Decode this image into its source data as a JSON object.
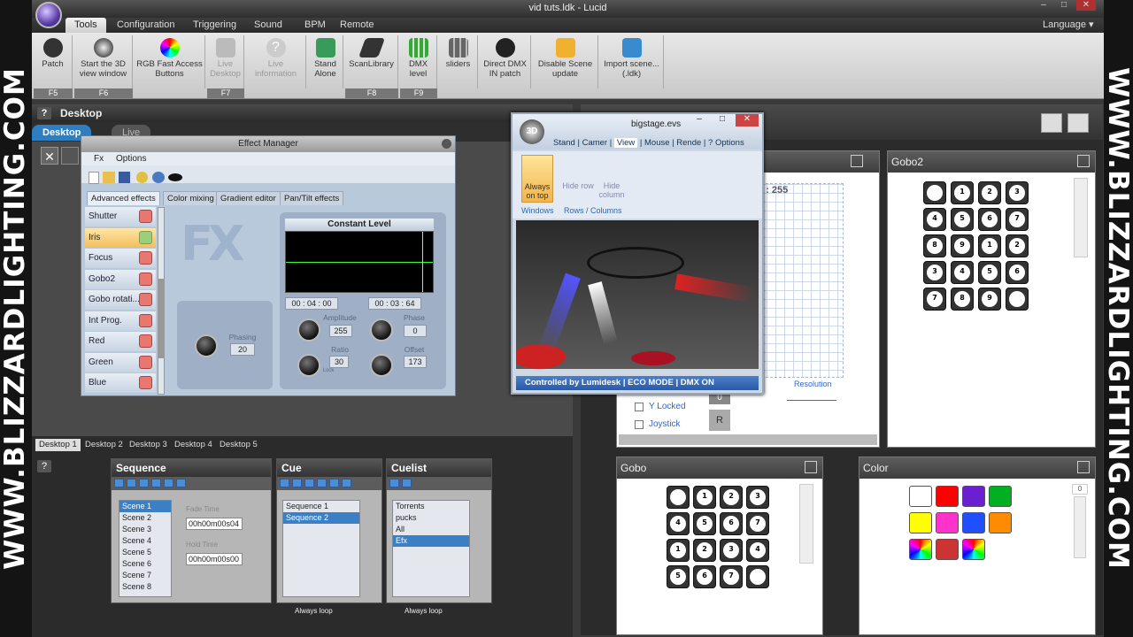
{
  "watermark": "WWW.BLIZZARDLIGHTING.COM",
  "window": {
    "title": "vid tuts.ldk - Lucid"
  },
  "menu": {
    "tabs": [
      "Tools",
      "Configuration",
      "Triggering",
      "Sound",
      "BPM",
      "Remote"
    ],
    "language": "Language"
  },
  "ribbon": {
    "buttons": [
      {
        "label": "Patch",
        "key": "F5"
      },
      {
        "label": "Start the 3D view window",
        "key": "F6"
      },
      {
        "label": "RGB Fast Access Buttons",
        "key": ""
      },
      {
        "label": "Live Desktop",
        "key": "F7"
      },
      {
        "label": "Live information",
        "key": ""
      },
      {
        "label": "Stand Alone",
        "key": ""
      },
      {
        "label": "ScanLibrary",
        "key": "F8"
      },
      {
        "label": "DMX level",
        "key": "F9"
      },
      {
        "label": "sliders",
        "key": ""
      },
      {
        "label": "Direct DMX IN patch",
        "key": ""
      },
      {
        "label": "Disable Scene update",
        "key": ""
      },
      {
        "label": "Import scene... (.ldk)",
        "key": ""
      }
    ]
  },
  "desktop": {
    "title": "Desktop",
    "tab_desktop": "Desktop",
    "tab_live": "Live",
    "help": "?"
  },
  "effect_manager": {
    "title": "Effect Manager",
    "menu": [
      "Fx",
      "Options"
    ],
    "tabs": [
      "Advanced effects",
      "Color mixing",
      "Gradient editor",
      "Pan/Tilt effects"
    ],
    "items": [
      "Shutter",
      "Iris",
      "Focus",
      "Gobo2",
      "Gobo rotati...",
      "Int Prog.",
      "Red",
      "Green",
      "Blue"
    ],
    "wave_title": "Constant Level",
    "time_start": "00 : 04 : 00",
    "time_end": "00 : 03 : 64",
    "phasing_label": "Phasing",
    "phasing_value": "20",
    "amplitude_label": "Amplitude",
    "amplitude_value": "255",
    "phase_label": "Phase",
    "phase_value": "0",
    "ratio_label": "Ratio",
    "ratio_value": "30",
    "offset_label": "Offset",
    "offset_value": "173",
    "lock_label": "Lock"
  },
  "view3d": {
    "title": "bigstage.evs",
    "tabs": [
      "Stand",
      "Camer",
      "View",
      "Mouse",
      "Rende",
      "?",
      "Options"
    ],
    "always_on_top": "Always on top",
    "hide_row": "Hide row",
    "hide_column": "Hide column",
    "group_windows": "Windows",
    "group_rows": "Rows / Columns",
    "status": "Controlled by Lumidesk  |  ECO MODE  |  DMX ON"
  },
  "right": {
    "xy_readout": "Y : 255",
    "resolution": "Resolution",
    "y_locked": "Y Locked",
    "joystick": "Joystick",
    "r_btn": "R",
    "zero_btn": "0",
    "gobo2_title": "Gobo2",
    "gobo_title": "Gobo",
    "color_title": "Color",
    "gobo2_labels": [
      "",
      "1",
      "2",
      "3",
      "4",
      "5",
      "6",
      "7",
      "8",
      "9",
      "1",
      "2",
      "3",
      "4",
      "5",
      "6",
      "7",
      "8",
      "9",
      ""
    ],
    "gobo_labels": [
      "",
      "1",
      "2",
      "3",
      "4",
      "5",
      "6",
      "7",
      "1",
      "2",
      "3",
      "4",
      "5",
      "6",
      "7",
      ""
    ],
    "color_slider_value": "0",
    "colors": [
      "#ffffff",
      "#ff0000",
      "#6a1fd0",
      "#00b020",
      "#ffff00",
      "#ff33cc",
      "#1f4fff",
      "#ff8c00"
    ]
  },
  "desktop_tabs": [
    "Desktop 1",
    "Desktop 2",
    "Desktop 3",
    "Desktop 4",
    "Desktop 5"
  ],
  "sequence": {
    "title": "Sequence",
    "items": [
      "Scene 1",
      "Scene 2",
      "Scene 3",
      "Scene 4",
      "Scene 5",
      "Scene 6",
      "Scene 7",
      "Scene 8"
    ],
    "fade_label": "Fade Time",
    "fade_value": "00h00m00s04",
    "hold_label": "Hold Time",
    "hold_value": "00h00m00s00"
  },
  "cue": {
    "title": "Cue",
    "items": [
      "Sequence 1",
      "Sequence 2"
    ],
    "loop": "Always loop"
  },
  "cuelist": {
    "title": "Cuelist",
    "items": [
      "Torrents",
      "pucks",
      "All",
      "Efx"
    ],
    "loop": "Always loop"
  }
}
